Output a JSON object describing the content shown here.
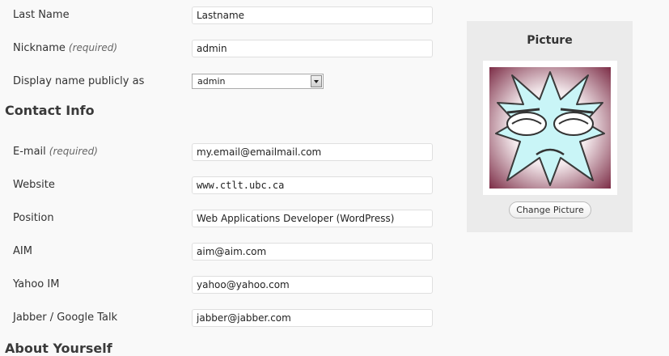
{
  "name": {
    "last_name_label": "Last Name",
    "last_name_value": "Lastname",
    "nickname_label": "Nickname",
    "nickname_required": "(required)",
    "nickname_value": "admin",
    "display_name_label": "Display name publicly as",
    "display_name_selected": "admin"
  },
  "contact": {
    "heading": "Contact Info",
    "email_label": "E-mail",
    "email_required": "(required)",
    "email_value": "my.email@emailmail.com",
    "website_label": "Website",
    "website_value": "www.ctlt.ubc.ca",
    "position_label": "Position",
    "position_value": "Web Applications Developer (WordPress)",
    "aim_label": "AIM",
    "aim_value": "aim@aim.com",
    "yahoo_label": "Yahoo IM",
    "yahoo_value": "yahoo@yahoo.com",
    "jabber_label": "Jabber / Google Talk",
    "jabber_value": "jabber@jabber.com"
  },
  "about": {
    "heading": "About Yourself"
  },
  "picture": {
    "title": "Picture",
    "change_button_label": "Change Picture",
    "avatar_icon": "angry-star-avatar-icon"
  },
  "colors": {
    "page_bg": "#f9f9f9",
    "panel_bg": "#ebebeb",
    "avatar_star": "#c8f4f6",
    "avatar_bg": "#8a3a55"
  }
}
